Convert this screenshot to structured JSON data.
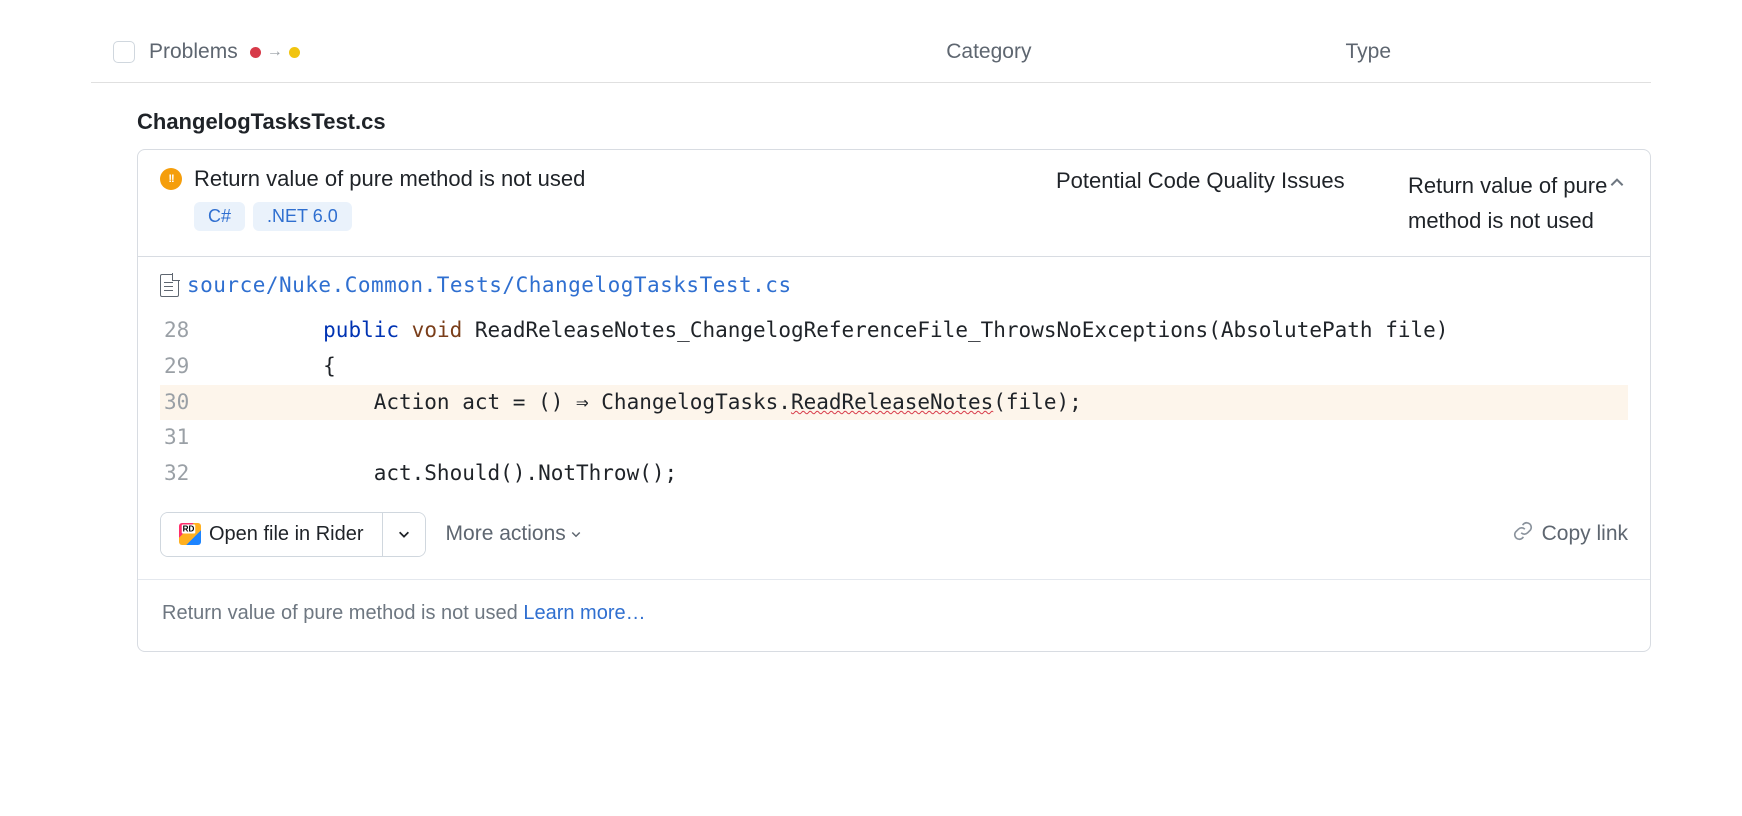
{
  "header": {
    "problems_label": "Problems",
    "category_label": "Category",
    "type_label": "Type"
  },
  "file": {
    "name": "ChangelogTasksTest.cs"
  },
  "issue": {
    "title": "Return value of pure method is not used",
    "tags": [
      "C#",
      ".NET 6.0"
    ],
    "category": "Potential Code Quality Issues",
    "type": "Return value of pure method is not used"
  },
  "code": {
    "path": "source/Nuke.Common.Tests/ChangelogTasksTest.cs",
    "lines": [
      {
        "n": "28",
        "segments": [
          {
            "t": "        ",
            "c": ""
          },
          {
            "t": "public",
            "c": "kw"
          },
          {
            "t": " ",
            "c": ""
          },
          {
            "t": "void",
            "c": "kw2"
          },
          {
            "t": " ReadReleaseNotes_ChangelogReferenceFile_ThrowsNoExceptions(AbsolutePath file)",
            "c": ""
          }
        ]
      },
      {
        "n": "29",
        "segments": [
          {
            "t": "        {",
            "c": ""
          }
        ]
      },
      {
        "n": "30",
        "hl": true,
        "segments": [
          {
            "t": "            Action act = () ⇒ ChangelogTasks.",
            "c": ""
          },
          {
            "t": "ReadReleaseNotes",
            "c": "squiggle"
          },
          {
            "t": "(file);",
            "c": ""
          }
        ]
      },
      {
        "n": "31",
        "segments": [
          {
            "t": "",
            "c": ""
          }
        ]
      },
      {
        "n": "32",
        "segments": [
          {
            "t": "            act.Should().NotThrow();",
            "c": ""
          }
        ]
      }
    ]
  },
  "actions": {
    "open_in_rider": "Open file in Rider",
    "more_actions": "More actions",
    "copy_link": "Copy link"
  },
  "footer": {
    "text": "Return value of pure method is not used",
    "learn_more": "Learn more…"
  }
}
